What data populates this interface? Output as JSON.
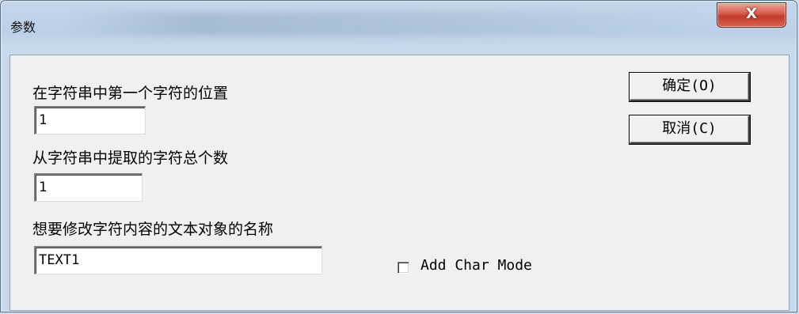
{
  "window": {
    "title": "参数",
    "close_glyph": "X"
  },
  "fields": {
    "start_position": {
      "label": "在字符串中第一个字符的位置",
      "value": "1"
    },
    "char_count": {
      "label": "从字符串中提取的字符总个数",
      "value": "1"
    },
    "text_object": {
      "label": "想要修改字符内容的文本对象的名称",
      "value": "TEXT1"
    }
  },
  "buttons": {
    "ok": "确定(O)",
    "cancel": "取消(C)"
  },
  "options": {
    "add_char_mode": {
      "label": "Add Char Mode",
      "checked": false
    }
  },
  "colors": {
    "close_button": "#c23a2b",
    "dialog_face": "#f0f0f0",
    "titlebar": "#c5d6ea"
  }
}
